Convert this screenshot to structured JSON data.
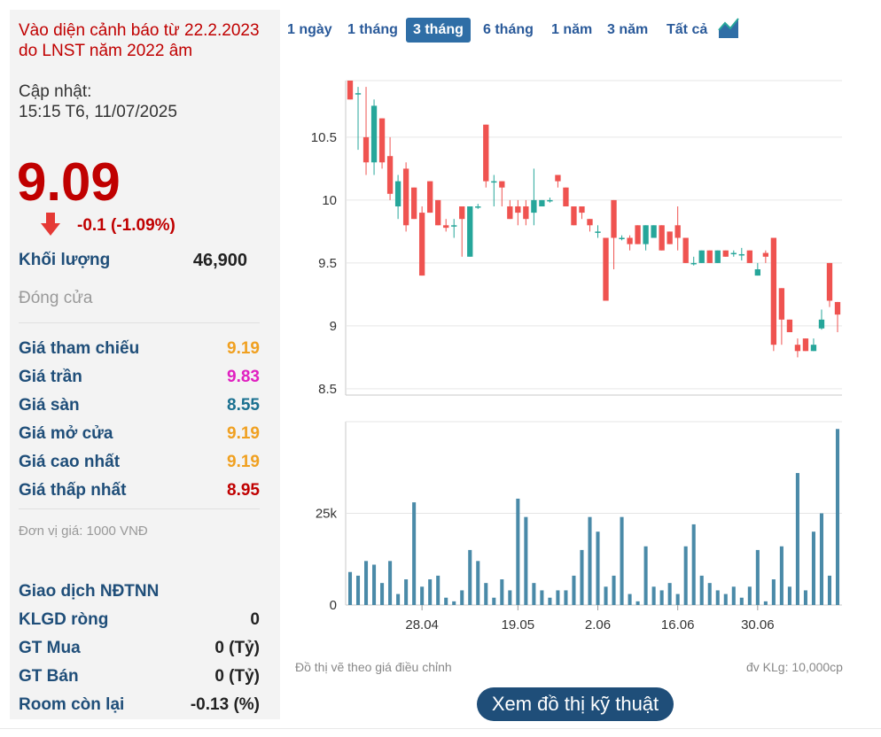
{
  "info": {
    "warning": "Vào diện cảnh báo từ 22.2.2023 do LNST năm 2022 âm",
    "updated_label": "Cập nhật:",
    "updated_time": "15:15 T6, 11/07/2025",
    "price": "9.09",
    "change": "-0.1 (-1.09%)",
    "volume_label": "Khối lượng",
    "volume_value": "46,900",
    "close_label": "Đóng cửa",
    "rows": [
      {
        "label": "Giá tham chiếu",
        "value": "9.19",
        "color": "#f0a020"
      },
      {
        "label": "Giá trần",
        "value": "9.83",
        "color": "#e020c0"
      },
      {
        "label": "Giá sàn",
        "value": "8.55",
        "color": "#1a7090"
      },
      {
        "label": "Giá mở cửa",
        "value": "9.19",
        "color": "#f0a020"
      },
      {
        "label": "Giá cao nhất",
        "value": "9.19",
        "color": "#f0a020"
      },
      {
        "label": "Giá thấp nhất",
        "value": "8.95",
        "color": "#c00000"
      }
    ],
    "unit_note": "Đơn vị giá: 1000 VNĐ",
    "foreign_title": "Giao dịch NĐTNN",
    "foreign_rows": [
      {
        "label": "KLGD ròng",
        "value": "0"
      },
      {
        "label": "GT Mua",
        "value": "0 (Tỷ)"
      },
      {
        "label": "GT Bán",
        "value": "0 (Tỷ)"
      },
      {
        "label": "Room còn lại",
        "value": "-0.13 (%)"
      }
    ]
  },
  "tabs": [
    "1 ngày",
    "1 tháng",
    "3 tháng",
    "6 tháng",
    "1 năm",
    "3 năm",
    "Tất cả"
  ],
  "active_tab": 2,
  "colors": {
    "up": "#26a69a",
    "down": "#ef5350",
    "volume": "#4a8aa8",
    "price_red": "#c00000",
    "accent": "#1f4e79"
  },
  "notes": {
    "left": "Đồ thị vẽ theo giá điều chỉnh",
    "right": "đv KLg: 10,000cp"
  },
  "tech_button": "Xem đồ thị kỹ thuật",
  "chart_data": {
    "type": "candlestick",
    "y_ticks": [
      10.5,
      10,
      9.5,
      9,
      8.5
    ],
    "y_ticks_labels": [
      "10.5",
      "10",
      "9.5",
      "9",
      "8.5"
    ],
    "ylim": [
      8.45,
      10.95
    ],
    "x_ticks": [
      {
        "label": "28.04",
        "index": 9
      },
      {
        "label": "19.05",
        "index": 21
      },
      {
        "label": "2.06",
        "index": 31
      },
      {
        "label": "16.06",
        "index": 41
      },
      {
        "label": "30.06",
        "index": 51
      }
    ],
    "vol_ticks": [
      {
        "label": "25k",
        "value": 25000
      },
      {
        "label": "0",
        "value": 0
      }
    ],
    "vol_max": 50000,
    "candles": [
      {
        "o": 10.95,
        "h": 10.95,
        "l": 10.8,
        "c": 10.8
      },
      {
        "o": 10.85,
        "h": 10.9,
        "l": 10.4,
        "c": 10.85
      },
      {
        "o": 10.5,
        "h": 10.9,
        "l": 10.2,
        "c": 10.3
      },
      {
        "o": 10.3,
        "h": 10.8,
        "l": 10.2,
        "c": 10.75
      },
      {
        "o": 10.65,
        "h": 10.65,
        "l": 10.25,
        "c": 10.3
      },
      {
        "o": 10.35,
        "h": 10.5,
        "l": 10.0,
        "c": 10.05
      },
      {
        "o": 9.95,
        "h": 10.2,
        "l": 9.85,
        "c": 10.15
      },
      {
        "o": 10.25,
        "h": 10.3,
        "l": 9.75,
        "c": 9.8
      },
      {
        "o": 10.1,
        "h": 10.1,
        "l": 9.85,
        "c": 9.85
      },
      {
        "o": 9.9,
        "h": 9.95,
        "l": 9.4,
        "c": 9.4
      },
      {
        "o": 10.15,
        "h": 10.15,
        "l": 9.9,
        "c": 9.9
      },
      {
        "o": 10.0,
        "h": 10.0,
        "l": 9.8,
        "c": 9.8
      },
      {
        "o": 9.8,
        "h": 9.85,
        "l": 9.75,
        "c": 9.78
      },
      {
        "o": 9.8,
        "h": 9.85,
        "l": 9.7,
        "c": 9.8
      },
      {
        "o": 9.95,
        "h": 9.95,
        "l": 9.55,
        "c": 9.85
      },
      {
        "o": 9.55,
        "h": 9.95,
        "l": 9.55,
        "c": 9.95
      },
      {
        "o": 9.95,
        "h": 9.97,
        "l": 9.93,
        "c": 9.95
      },
      {
        "o": 10.6,
        "h": 10.6,
        "l": 10.1,
        "c": 10.15
      },
      {
        "o": 10.15,
        "h": 10.2,
        "l": 9.95,
        "c": 10.15
      },
      {
        "o": 10.15,
        "h": 10.15,
        "l": 9.95,
        "c": 10.1
      },
      {
        "o": 9.95,
        "h": 10.0,
        "l": 9.85,
        "c": 9.85
      },
      {
        "o": 9.95,
        "h": 10.0,
        "l": 9.8,
        "c": 9.9
      },
      {
        "o": 9.95,
        "h": 10.0,
        "l": 9.8,
        "c": 9.85
      },
      {
        "o": 9.9,
        "h": 10.25,
        "l": 9.8,
        "c": 10.0
      },
      {
        "o": 9.95,
        "h": 10.0,
        "l": 9.95,
        "c": 10.0
      },
      {
        "o": 10.0,
        "h": 10.02,
        "l": 9.98,
        "c": 10.0
      },
      {
        "o": 10.2,
        "h": 10.2,
        "l": 10.1,
        "c": 10.15
      },
      {
        "o": 10.1,
        "h": 10.1,
        "l": 9.95,
        "c": 9.95
      },
      {
        "o": 9.95,
        "h": 9.95,
        "l": 9.8,
        "c": 9.8
      },
      {
        "o": 9.95,
        "h": 9.95,
        "l": 9.85,
        "c": 9.9
      },
      {
        "o": 9.85,
        "h": 9.85,
        "l": 9.75,
        "c": 9.8
      },
      {
        "o": 9.75,
        "h": 9.8,
        "l": 9.7,
        "c": 9.75
      },
      {
        "o": 9.7,
        "h": 9.7,
        "l": 9.2,
        "c": 9.2
      },
      {
        "o": 10.0,
        "h": 10.0,
        "l": 9.45,
        "c": 9.7
      },
      {
        "o": 9.7,
        "h": 9.72,
        "l": 9.68,
        "c": 9.7
      },
      {
        "o": 9.7,
        "h": 9.72,
        "l": 9.6,
        "c": 9.65
      },
      {
        "o": 9.8,
        "h": 9.8,
        "l": 9.65,
        "c": 9.65
      },
      {
        "o": 9.65,
        "h": 9.8,
        "l": 9.6,
        "c": 9.8
      },
      {
        "o": 9.7,
        "h": 9.8,
        "l": 9.7,
        "c": 9.8
      },
      {
        "o": 9.8,
        "h": 9.8,
        "l": 9.6,
        "c": 9.6
      },
      {
        "o": 9.75,
        "h": 9.75,
        "l": 9.65,
        "c": 9.65
      },
      {
        "o": 9.8,
        "h": 9.95,
        "l": 9.6,
        "c": 9.7
      },
      {
        "o": 9.7,
        "h": 9.7,
        "l": 9.5,
        "c": 9.5
      },
      {
        "o": 9.5,
        "h": 9.55,
        "l": 9.48,
        "c": 9.5
      },
      {
        "o": 9.5,
        "h": 9.6,
        "l": 9.5,
        "c": 9.6
      },
      {
        "o": 9.6,
        "h": 9.6,
        "l": 9.5,
        "c": 9.5
      },
      {
        "o": 9.5,
        "h": 9.6,
        "l": 9.5,
        "c": 9.6
      },
      {
        "o": 9.6,
        "h": 9.6,
        "l": 9.55,
        "c": 9.55
      },
      {
        "o": 9.58,
        "h": 9.6,
        "l": 9.55,
        "c": 9.58
      },
      {
        "o": 9.57,
        "h": 9.62,
        "l": 9.52,
        "c": 9.57
      },
      {
        "o": 9.6,
        "h": 9.6,
        "l": 9.5,
        "c": 9.5
      },
      {
        "o": 9.4,
        "h": 9.5,
        "l": 9.4,
        "c": 9.45
      },
      {
        "o": 9.58,
        "h": 9.6,
        "l": 9.5,
        "c": 9.55
      },
      {
        "o": 9.7,
        "h": 9.7,
        "l": 8.8,
        "c": 8.85
      },
      {
        "o": 9.3,
        "h": 9.3,
        "l": 8.85,
        "c": 9.05
      },
      {
        "o": 9.05,
        "h": 9.05,
        "l": 8.95,
        "c": 8.95
      },
      {
        "o": 8.85,
        "h": 8.9,
        "l": 8.75,
        "c": 8.8
      },
      {
        "o": 8.9,
        "h": 8.9,
        "l": 8.8,
        "c": 8.8
      },
      {
        "o": 8.8,
        "h": 8.9,
        "l": 8.8,
        "c": 8.85
      },
      {
        "o": 8.98,
        "h": 9.13,
        "l": 8.97,
        "c": 9.05
      },
      {
        "o": 9.5,
        "h": 9.5,
        "l": 9.15,
        "c": 9.2
      },
      {
        "o": 9.19,
        "h": 9.19,
        "l": 8.95,
        "c": 9.09
      }
    ],
    "volumes": [
      9000,
      8000,
      12000,
      11000,
      6000,
      12000,
      3000,
      7000,
      28000,
      5000,
      7000,
      8000,
      2000,
      1000,
      4000,
      15000,
      12000,
      6000,
      2000,
      7000,
      4000,
      29000,
      24000,
      6000,
      4000,
      2000,
      4000,
      4000,
      8000,
      15000,
      24000,
      20000,
      5000,
      8000,
      24000,
      3000,
      1000,
      16000,
      5000,
      4000,
      6000,
      3000,
      16000,
      22000,
      8000,
      6000,
      4000,
      3000,
      5000,
      2000,
      5000,
      15000,
      1000,
      7000,
      16000,
      5000,
      36000,
      4000,
      20000,
      25000,
      8000,
      48000
    ]
  }
}
